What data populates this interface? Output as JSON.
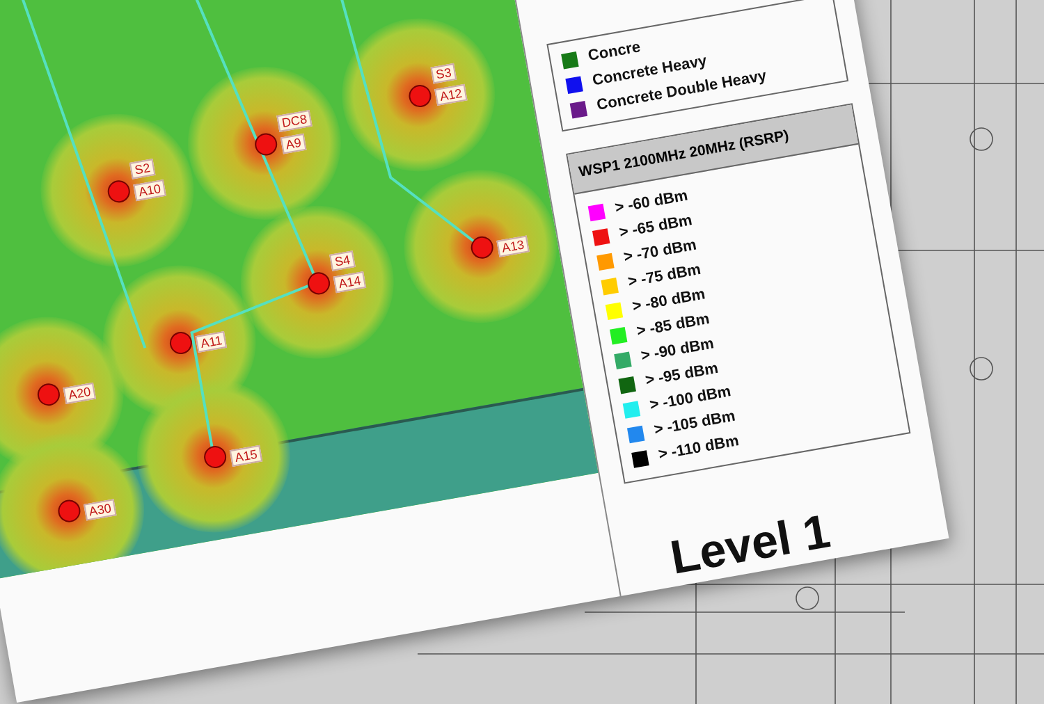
{
  "floor_title": "Level 1",
  "wall_legend": [
    {
      "label": "Concre",
      "color": "#177a17"
    },
    {
      "label": "Concrete Heavy",
      "color": "#1010ee"
    },
    {
      "label": "Concrete Double Heavy",
      "color": "#6a1a8a"
    }
  ],
  "signal_legend": {
    "title": "WSP1 2100MHz 20MHz (RSRP)",
    "items": [
      {
        "label": "> -60 dBm",
        "color": "#ff00ff"
      },
      {
        "label": "> -65 dBm",
        "color": "#ee1111"
      },
      {
        "label": "> -70 dBm",
        "color": "#ff9900"
      },
      {
        "label": "> -75 dBm",
        "color": "#ffcc00"
      },
      {
        "label": "> -80 dBm",
        "color": "#ffff00"
      },
      {
        "label": "> -85 dBm",
        "color": "#22ee22"
      },
      {
        "label": "> -90 dBm",
        "color": "#33aa66"
      },
      {
        "label": "> -95 dBm",
        "color": "#116611"
      },
      {
        "label": "> -100 dBm",
        "color": "#22eeee"
      },
      {
        "label": "> -105 dBm",
        "color": "#2288ee"
      },
      {
        "label": "> -110 dBm",
        "color": "#000000"
      }
    ]
  },
  "access_points": [
    {
      "label": "A10",
      "tag": "S2"
    },
    {
      "label": "A9",
      "tag": "DC8"
    },
    {
      "label": "A12",
      "tag": "S3"
    },
    {
      "label": "A11"
    },
    {
      "label": "A14",
      "tag": "S4"
    },
    {
      "label": "A13"
    },
    {
      "label": "A20"
    },
    {
      "label": "A15"
    },
    {
      "label": "A30"
    }
  ]
}
